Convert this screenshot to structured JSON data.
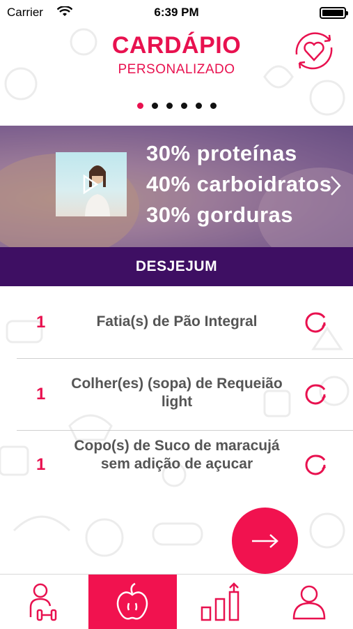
{
  "status_bar": {
    "carrier": "Carrier",
    "time": "6:39 PM"
  },
  "header": {
    "title": "CARDÁPIO",
    "subtitle": "PERSONALIZADO",
    "action_icon": "heart-refresh-icon"
  },
  "pager": {
    "count": 6,
    "active_index": 0
  },
  "banner": {
    "macros": [
      "30% proteínas",
      "40% carboidratos",
      "30% gorduras"
    ],
    "video_icon": "play-icon",
    "next_icon": "chevron-right-icon"
  },
  "meal": {
    "title": "DESJEJUM",
    "items": [
      {
        "qty": "1",
        "name": "Fatia(s) de Pão Integral"
      },
      {
        "qty": "1",
        "name": "Colher(es) (sopa) de Requeião light"
      },
      {
        "qty": "1",
        "name": "Copo(s) de Suco de maracujá sem adição de açucar"
      }
    ],
    "swap_icon": "refresh-icon"
  },
  "fab": {
    "icon": "arrow-right-icon"
  },
  "tabs": [
    {
      "icon": "person-weights-icon",
      "active": false
    },
    {
      "icon": "apple-icon",
      "active": true
    },
    {
      "icon": "bar-chart-up-icon",
      "active": false
    },
    {
      "icon": "profile-icon",
      "active": false
    }
  ],
  "colors": {
    "accent": "#e8114f",
    "meal_bar": "#3e0f63"
  }
}
